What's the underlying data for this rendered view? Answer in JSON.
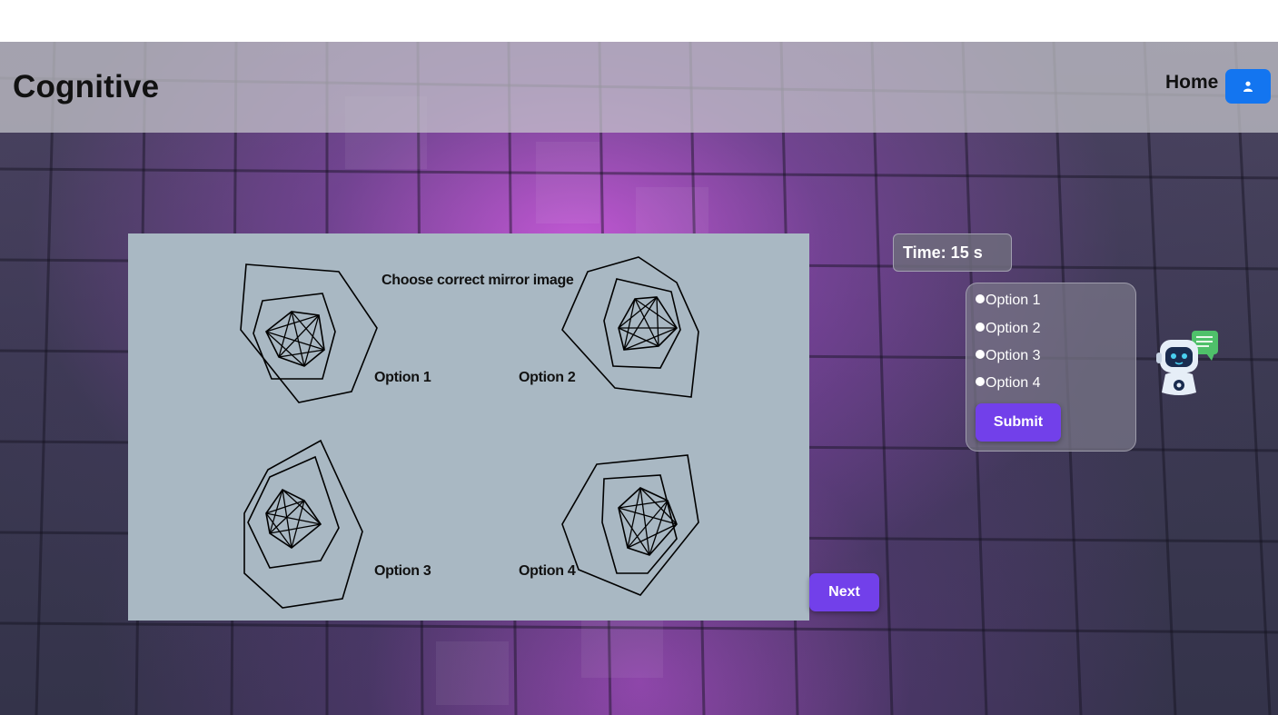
{
  "header": {
    "brand": "Cognitive",
    "nav": {
      "home": "Home"
    },
    "user_icon": "user-icon"
  },
  "question": {
    "prompt": "Choose correct mirror image",
    "figures": [
      {
        "label": "Option 1"
      },
      {
        "label": "Option 2"
      },
      {
        "label": "Option 3"
      },
      {
        "label": "Option 4"
      }
    ]
  },
  "timer": {
    "text": "Time: 15 s"
  },
  "answers": {
    "options": [
      "Option 1",
      "Option 2",
      "Option 3",
      "Option 4"
    ],
    "submit_label": "Submit"
  },
  "next_label": "Next",
  "chatbot_icon": "chatbot-icon",
  "colors": {
    "accent": "#7240ea",
    "user_button": "#1375f0",
    "panel": "#a9b8c3"
  }
}
